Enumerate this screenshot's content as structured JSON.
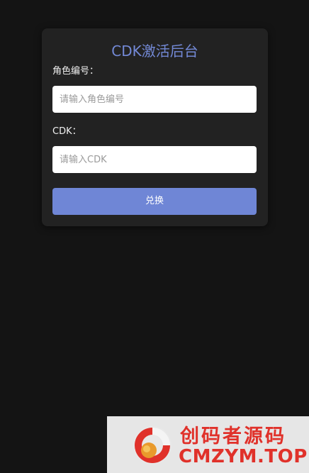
{
  "card": {
    "title": "CDK激活后台",
    "role_label": "角色编号：",
    "role_placeholder": "请输入角色编号",
    "role_value": "",
    "cdk_label": "CDK：",
    "cdk_placeholder": "请输入CDK",
    "cdk_value": "",
    "submit_label": "兑换"
  },
  "watermark": {
    "cn_text": "创码者源码",
    "en_text": "CMZYM.TOP",
    "icon": "cmzym-logo-icon"
  },
  "colors": {
    "background": "#141414",
    "card": "#222222",
    "accent": "#6f86d6",
    "title": "#7389d6",
    "watermark_text": "#e0312a"
  }
}
